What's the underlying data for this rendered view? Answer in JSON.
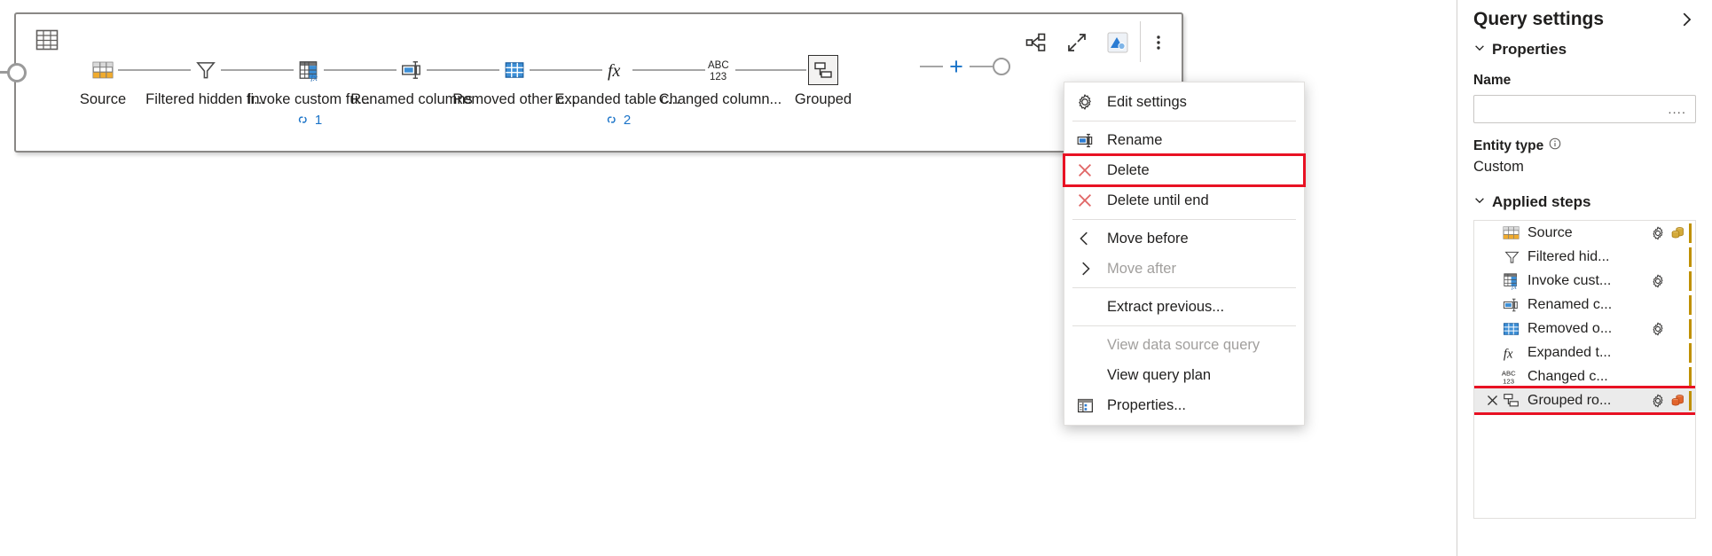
{
  "diagram": {
    "grid_icon": "table-grid-icon",
    "toolbar": [
      {
        "name": "diagram-view-icon",
        "label": "Diagram view"
      },
      {
        "name": "collapse-icon",
        "label": "Collapse"
      },
      {
        "name": "data-preview-icon",
        "label": "Data preview"
      },
      {
        "name": "more-options-icon",
        "label": "More options"
      }
    ],
    "steps": [
      {
        "label": "Source",
        "icon": "source-table-icon",
        "link_count": "",
        "selected": false
      },
      {
        "label": "Filtered hidden fi...",
        "icon": "filter-funnel-icon",
        "link_count": "",
        "selected": false
      },
      {
        "label": "Invoke custom fu...",
        "icon": "invoke-function-icon",
        "link_count": "1",
        "selected": false
      },
      {
        "label": "Renamed columns",
        "icon": "rename-column-icon",
        "link_count": "",
        "selected": false
      },
      {
        "label": "Removed other c...",
        "icon": "remove-columns-icon",
        "link_count": "",
        "selected": false
      },
      {
        "label": "Expanded table c...",
        "icon": "fx-icon",
        "link_count": "2",
        "selected": false
      },
      {
        "label": "Changed column...",
        "icon": "abc123-icon",
        "link_count": "",
        "selected": false
      },
      {
        "label": "Grouped",
        "icon": "group-rows-icon",
        "link_count": "",
        "selected": true
      }
    ],
    "add_step_label": "+"
  },
  "context_menu": {
    "items": [
      {
        "label": "Edit settings",
        "icon": "gear-icon",
        "disabled": false,
        "highlighted": false,
        "separator_after": true
      },
      {
        "label": "Rename",
        "icon": "rename-icon",
        "disabled": false,
        "highlighted": false,
        "separator_after": false
      },
      {
        "label": "Delete",
        "icon": "delete-x-icon",
        "disabled": false,
        "highlighted": true,
        "separator_after": false
      },
      {
        "label": "Delete until end",
        "icon": "delete-x-icon",
        "disabled": false,
        "highlighted": false,
        "separator_after": true
      },
      {
        "label": "Move before",
        "icon": "chevron-left-icon",
        "disabled": false,
        "highlighted": false,
        "separator_after": false
      },
      {
        "label": "Move after",
        "icon": "chevron-right-icon",
        "disabled": true,
        "highlighted": false,
        "separator_after": true
      },
      {
        "label": "Extract previous...",
        "icon": "none",
        "disabled": false,
        "highlighted": false,
        "separator_after": true
      },
      {
        "label": "View data source query",
        "icon": "none",
        "disabled": true,
        "highlighted": false,
        "separator_after": false
      },
      {
        "label": "View query plan",
        "icon": "none",
        "disabled": false,
        "highlighted": false,
        "separator_after": false
      },
      {
        "label": "Properties...",
        "icon": "properties-icon",
        "disabled": false,
        "highlighted": false,
        "separator_after": false
      }
    ]
  },
  "sidebar": {
    "title": "Query settings",
    "collapse_icon": "chevron-right-icon",
    "properties": {
      "section_label": "Properties",
      "name_label": "Name",
      "name_value": "....",
      "name_placeholder": "",
      "entity_type_label": "Entity type",
      "entity_type_info_icon": "info-icon",
      "entity_type_value": "Custom"
    },
    "applied_steps": {
      "section_label": "Applied steps",
      "rows": [
        {
          "label": "Source",
          "icon": "source-table-icon",
          "gear": true,
          "db": true,
          "db_color": "#c19a2e",
          "x": false,
          "selected": false,
          "highlighted": false
        },
        {
          "label": "Filtered hid...",
          "icon": "filter-funnel-icon",
          "gear": false,
          "db": false,
          "db_color": "",
          "x": false,
          "selected": false,
          "highlighted": false
        },
        {
          "label": "Invoke cust...",
          "icon": "invoke-function-icon",
          "gear": true,
          "db": false,
          "db_color": "",
          "x": false,
          "selected": false,
          "highlighted": false
        },
        {
          "label": "Renamed c...",
          "icon": "rename-column-icon",
          "gear": false,
          "db": false,
          "db_color": "",
          "x": false,
          "selected": false,
          "highlighted": false
        },
        {
          "label": "Removed o...",
          "icon": "remove-columns-icon",
          "gear": true,
          "db": false,
          "db_color": "",
          "x": false,
          "selected": false,
          "highlighted": false
        },
        {
          "label": "Expanded t...",
          "icon": "fx-icon",
          "gear": false,
          "db": false,
          "db_color": "",
          "x": false,
          "selected": false,
          "highlighted": false
        },
        {
          "label": "Changed c...",
          "icon": "abc123-icon",
          "gear": false,
          "db": false,
          "db_color": "",
          "x": false,
          "selected": false,
          "highlighted": false
        },
        {
          "label": "Grouped ro...",
          "icon": "group-rows-icon",
          "gear": true,
          "db": true,
          "db_color": "#d9632b",
          "x": true,
          "selected": true,
          "highlighted": true
        }
      ]
    }
  },
  "colors": {
    "accent_blue": "#1a73c8",
    "highlight_red": "#e81123",
    "step_bar_gold": "#bf9000",
    "panel_border": "#8a8886"
  }
}
